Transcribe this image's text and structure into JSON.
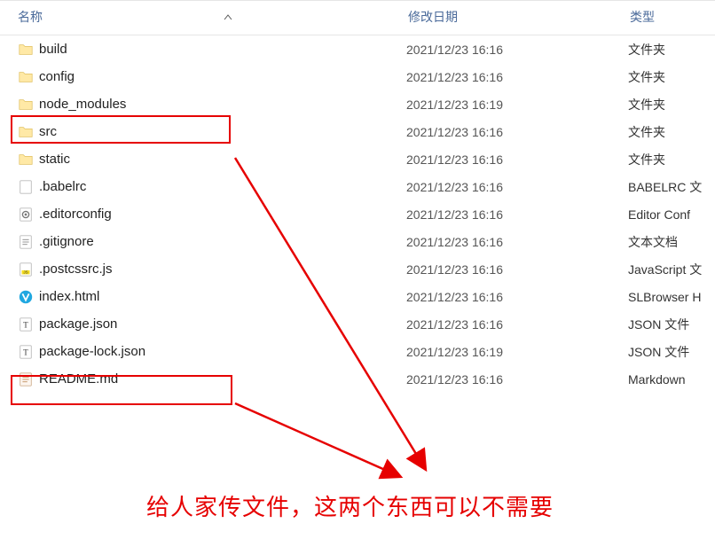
{
  "columns": {
    "name": "名称",
    "date": "修改日期",
    "type": "类型"
  },
  "files": [
    {
      "icon": "folder",
      "name": "build",
      "date": "2021/12/23 16:16",
      "type": "文件夹"
    },
    {
      "icon": "folder",
      "name": "config",
      "date": "2021/12/23 16:16",
      "type": "文件夹"
    },
    {
      "icon": "folder",
      "name": "node_modules",
      "date": "2021/12/23 16:19",
      "type": "文件夹"
    },
    {
      "icon": "folder",
      "name": "src",
      "date": "2021/12/23 16:16",
      "type": "文件夹"
    },
    {
      "icon": "folder",
      "name": "static",
      "date": "2021/12/23 16:16",
      "type": "文件夹"
    },
    {
      "icon": "file",
      "name": ".babelrc",
      "date": "2021/12/23 16:16",
      "type": "BABELRC 文"
    },
    {
      "icon": "ini",
      "name": ".editorconfig",
      "date": "2021/12/23 16:16",
      "type": "Editor Conf"
    },
    {
      "icon": "txt",
      "name": ".gitignore",
      "date": "2021/12/23 16:16",
      "type": "文本文档"
    },
    {
      "icon": "js",
      "name": ".postcssrc.js",
      "date": "2021/12/23 16:16",
      "type": "JavaScript 文"
    },
    {
      "icon": "html",
      "name": "index.html",
      "date": "2021/12/23 16:16",
      "type": "SLBrowser H"
    },
    {
      "icon": "json",
      "name": "package.json",
      "date": "2021/12/23 16:16",
      "type": "JSON 文件"
    },
    {
      "icon": "json",
      "name": "package-lock.json",
      "date": "2021/12/23 16:19",
      "type": "JSON 文件"
    },
    {
      "icon": "md",
      "name": "README.md",
      "date": "2021/12/23 16:16",
      "type": "Markdown"
    }
  ],
  "annotation": "给人家传文件，这两个东西可以不需要",
  "highlight_indices": [
    2,
    11
  ]
}
